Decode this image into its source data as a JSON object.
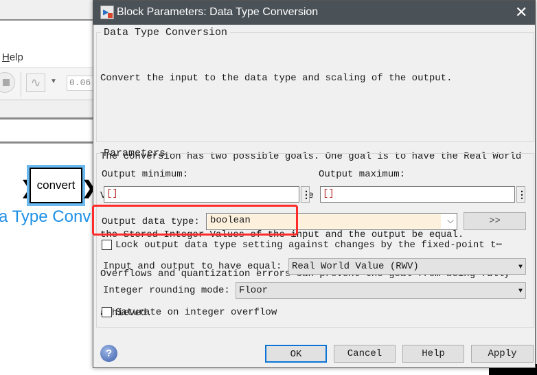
{
  "background": {
    "menu_help": "Help",
    "sim_time": "0.06",
    "block_label": "convert",
    "block_name": "a Type Conv",
    "accent": "#1e90e6"
  },
  "dialog": {
    "title": "Block Parameters: Data Type Conversion",
    "section1_title": "Data Type Conversion",
    "desc1": "Convert the input to the data type and scaling of the output.",
    "desc2": [
      "The conversion has two possible goals. One goal is to have the Real World",
      "Values of the input and the output be equal.  The other goal is to have",
      "the Stored Integer Values of the input and the output be equal.",
      "Overflows and quantization errors can prevent the goal from being fully",
      "achieved."
    ],
    "section2_title": "Parameters",
    "output_min_label": "Output minimum:",
    "output_min_value": "[]",
    "output_max_label": "Output maximum:",
    "output_max_value": "[]",
    "output_type_label": "Output data type:",
    "output_type_value": "boolean",
    "assistant_btn": ">>",
    "lock_label": "Lock output data type setting against changes by the fixed-point t⋯",
    "lock_checked": false,
    "equal_label": "Input and output to have equal:",
    "equal_value": "Real World Value (RWV)",
    "rounding_label": "Integer rounding mode:",
    "rounding_value": "Floor",
    "saturate_label": "Saturate on integer overflow",
    "saturate_checked": false,
    "buttons": {
      "ok": "OK",
      "cancel": "Cancel",
      "help": "Help",
      "apply": "Apply"
    },
    "highlight_color": "#ff2a2a"
  }
}
